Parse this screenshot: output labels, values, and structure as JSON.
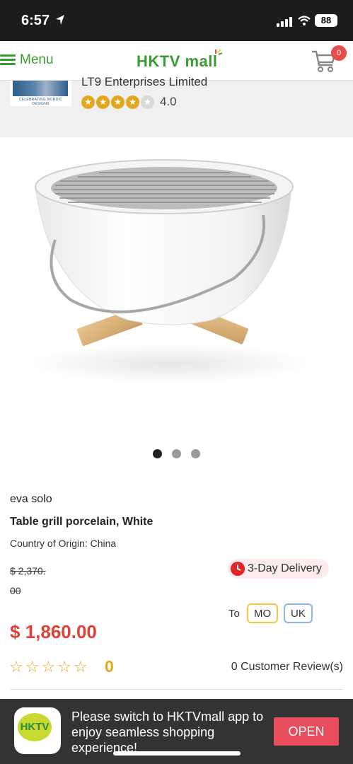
{
  "status": {
    "time": "6:57",
    "battery": "88"
  },
  "nav": {
    "menu_label": "Menu",
    "logo_text": "HKTV mall",
    "cart_count": "0"
  },
  "store": {
    "logo_caption": "CELEBRATING NORDIC DESIGNS",
    "name": "LT9 Enterprises Limited",
    "rating": "4.0",
    "stars_filled": 4,
    "stars_total": 5
  },
  "gallery": {
    "dot_count": 3,
    "active_index": 0
  },
  "product": {
    "brand": "eva solo",
    "title": "Table grill porcelain, White",
    "origin": "Country of Origin: China",
    "old_price": "$ 2,370. 00",
    "price": "$ 1,860.00",
    "delivery": "3-Day Delivery",
    "to_label": "To",
    "regions": [
      "MO",
      "UK"
    ],
    "review_count": "0",
    "customer_reviews": "0 Customer Review(s)"
  },
  "banner": {
    "app_icon_text": "HKTV",
    "text": "Please switch to HKTVmall app to enjoy seamless shopping experience!",
    "open_label": "OPEN"
  },
  "colors": {
    "brand_green": "#3a9b35",
    "price_red": "#e0403a",
    "star_gold": "#e1a71f",
    "open_button": "#e84d5d"
  }
}
